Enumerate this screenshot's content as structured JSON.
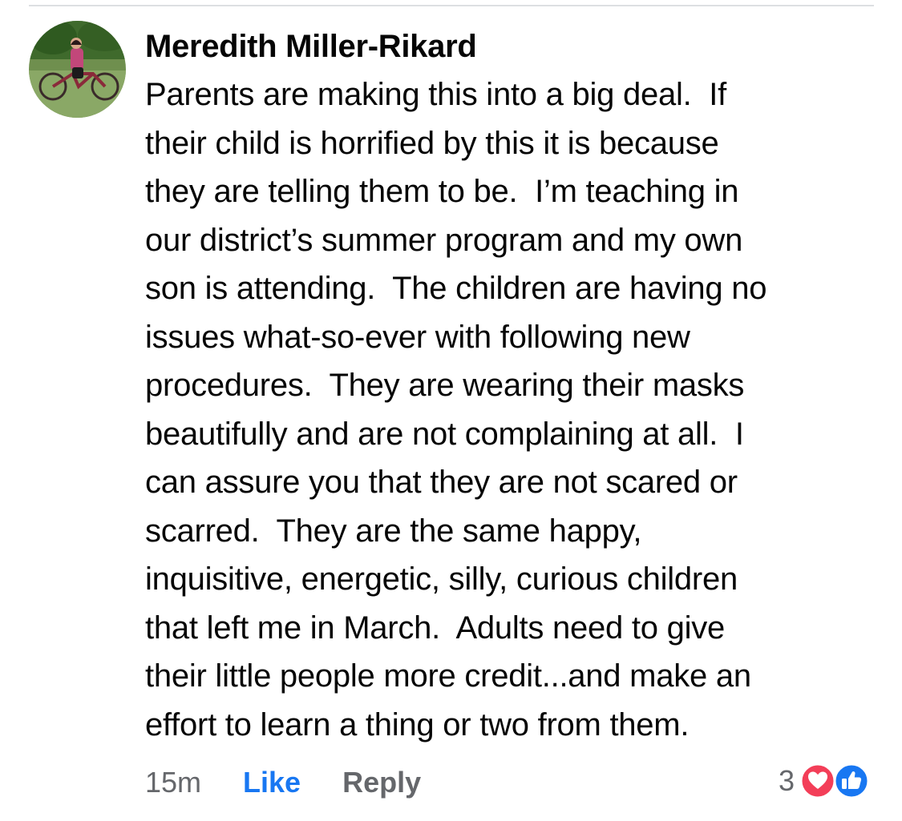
{
  "comment": {
    "author": "Meredith Miller-Rikard",
    "text_lines": [
      "Parents are making this into a big deal.  If",
      "their child is horrified by this it is because",
      "they are telling them to be.  I’m teaching in",
      "our district’s summer program and my own",
      "son is attending.  The children are having no",
      "issues what-so-ever with following new",
      "procedures.  They are wearing their masks",
      "beautifully and are not complaining at all.  I",
      "can assure you that they are not scared or",
      "scarred.  They are the same happy,",
      "inquisitive, energetic, silly, curious children",
      "that left me in March.  Adults need to give",
      "their little people more credit...and make an",
      "effort to learn a thing or two from them."
    ],
    "timestamp": "15m",
    "like_label": "Like",
    "reply_label": "Reply",
    "reaction_count": "3",
    "reaction_icons": [
      "love-icon",
      "like-icon"
    ]
  },
  "colors": {
    "text": "#050505",
    "secondary": "#65676b",
    "link_blue": "#1877f2",
    "love_red": "#f33e58",
    "divider": "#dddfe2"
  }
}
